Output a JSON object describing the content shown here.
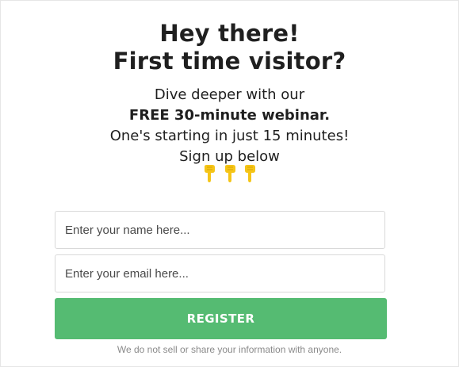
{
  "heading": {
    "line1": "Hey there!",
    "line2": "First time visitor?"
  },
  "subtext": {
    "line1": "Dive deeper with our",
    "line2": "FREE 30-minute webinar.",
    "line3": "One's starting in just 15 minutes!",
    "line4": "Sign up below"
  },
  "emojis": [
    "pointing-down-hand-icon",
    "pointing-down-hand-icon",
    "pointing-down-hand-icon"
  ],
  "form": {
    "name_placeholder": "Enter your name here...",
    "email_placeholder": "Enter your email here...",
    "register_label": "REGISTER"
  },
  "disclaimer": "We do not sell or share your information with anyone.",
  "colors": {
    "button": "#55bb72",
    "emoji": "#f5c518",
    "text": "#1f1f1f",
    "disclaimer": "#8a8a8a"
  }
}
